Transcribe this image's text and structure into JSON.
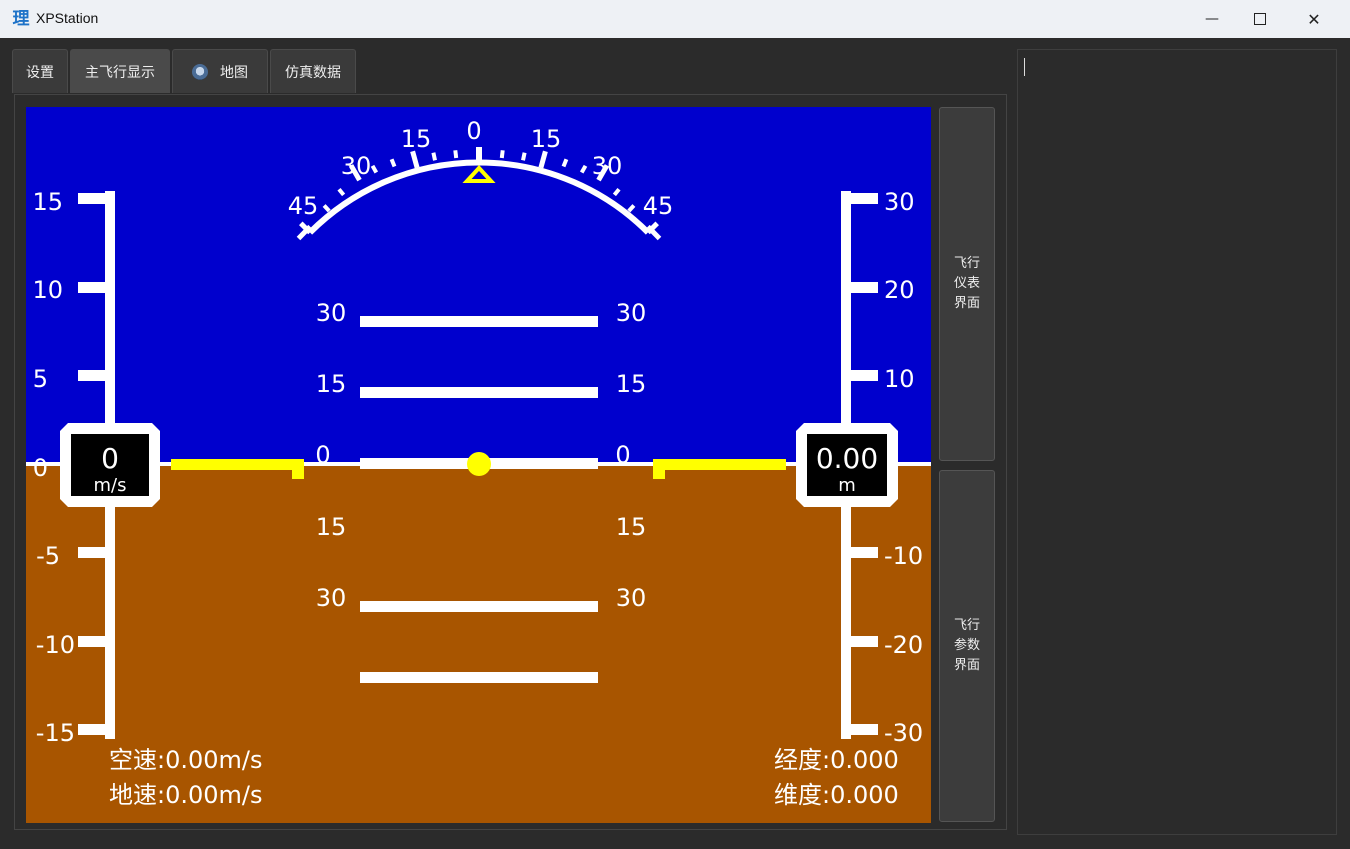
{
  "window": {
    "title": "XPStation",
    "icon_char": "理",
    "minimize_glyph": "—",
    "maximize_glyph": "☐",
    "close_glyph": "✕"
  },
  "tabs": [
    {
      "label": "设置"
    },
    {
      "label": "主飞行显示"
    },
    {
      "label": "地图"
    },
    {
      "label": "仿真数据"
    }
  ],
  "side_buttons": {
    "instrument": "飞行 仪表 界面",
    "params": "飞行 参数 界面"
  },
  "pfd": {
    "colors": {
      "sky": "#0000cd",
      "ground": "#a85500",
      "marker": "#ffff00",
      "line": "#ffffff"
    },
    "roll_labels": [
      "45",
      "30",
      "15",
      "0",
      "15",
      "30",
      "45"
    ],
    "pitch_labels": [
      "30",
      "15",
      "0",
      "15",
      "30"
    ],
    "speed_scale": [
      "15",
      "10",
      "5",
      "0",
      "-5",
      "-10",
      "-15"
    ],
    "alt_scale": [
      "30",
      "20",
      "10",
      "-10",
      "-20",
      "-30"
    ],
    "speed_value": "0",
    "speed_unit": "m/s",
    "alt_value": "0.00",
    "alt_unit": "m",
    "airspeed": "空速:0.00m/s",
    "groundspeed": "地速:0.00m/s",
    "longitude": "经度:0.000",
    "latitude": "维度:0.000"
  }
}
